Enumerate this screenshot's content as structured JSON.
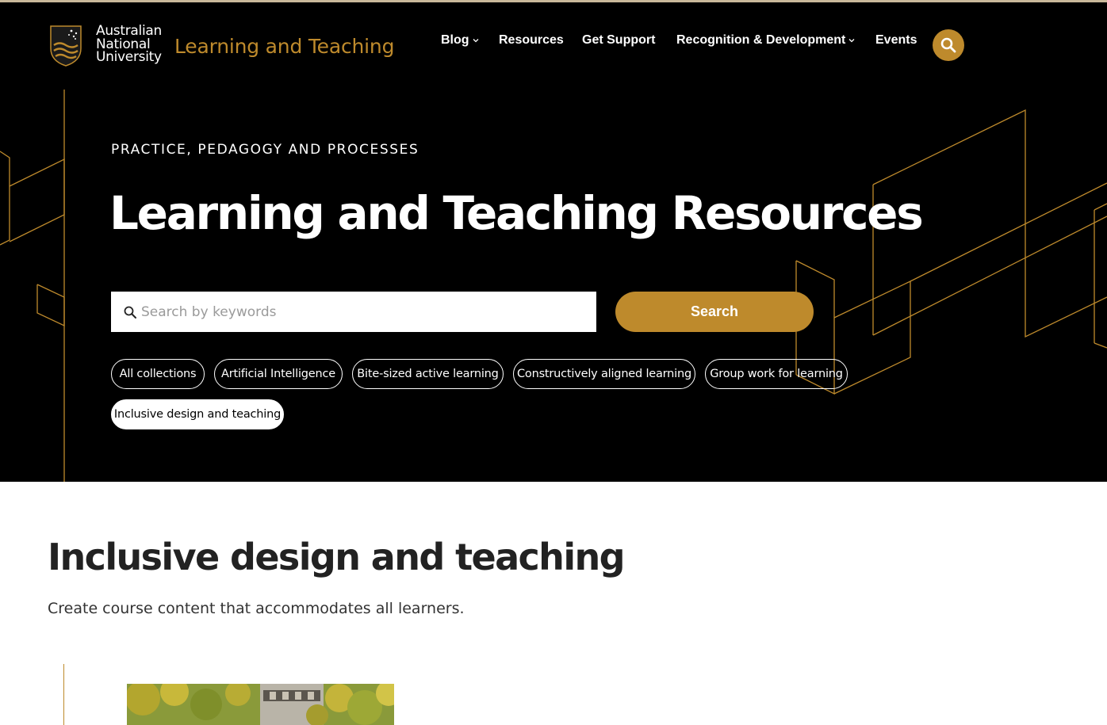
{
  "header": {
    "logo_lines": [
      "Australian",
      "National",
      "University"
    ],
    "site_title": "Learning and Teaching",
    "nav": [
      {
        "label": "Blog",
        "dropdown": true
      },
      {
        "label": "Resources",
        "dropdown": false
      },
      {
        "label": "Get Support",
        "dropdown": false
      },
      {
        "label": "Recognition & Development",
        "dropdown": true
      },
      {
        "label": "Events",
        "dropdown": false
      }
    ],
    "search_icon": "search-icon"
  },
  "hero": {
    "eyebrow": "PRACTICE, PEDAGOGY AND PROCESSES",
    "title": "Learning and Teaching Resources",
    "search_placeholder": "Search by keywords",
    "search_button": "Search",
    "chips": [
      {
        "label": "All collections",
        "active": false
      },
      {
        "label": "Artificial Intelligence",
        "active": false
      },
      {
        "label": "Bite-sized active learning",
        "active": false
      },
      {
        "label": "Constructively aligned learning",
        "active": false
      },
      {
        "label": "Group work for learning",
        "active": false
      },
      {
        "label": "Inclusive design and teaching",
        "active": true
      }
    ]
  },
  "content": {
    "title": "Inclusive design and teaching",
    "description": "Create course content that accommodates all learners."
  },
  "colors": {
    "accent_gold": "#be8a2c",
    "hero_bg": "#000000",
    "text_dark": "#222222"
  }
}
